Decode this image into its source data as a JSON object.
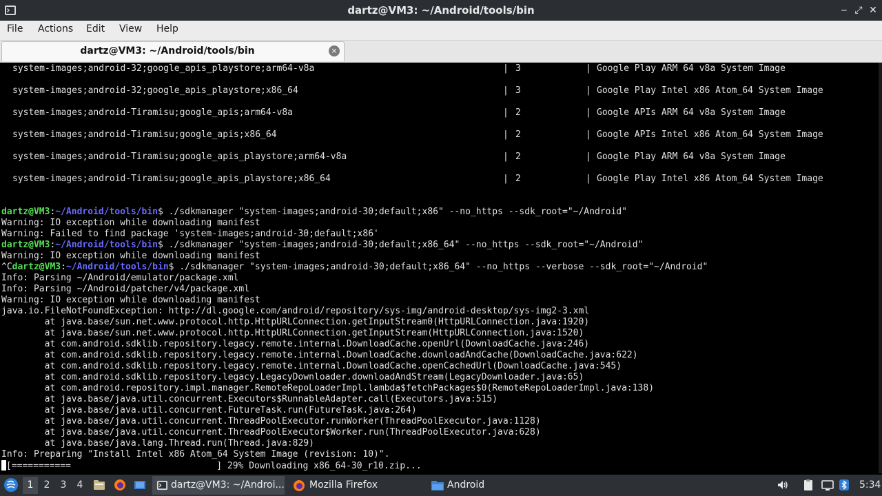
{
  "window": {
    "title": "dartz@VM3: ~/Android/tools/bin",
    "app_icon": "terminal-icon",
    "controls": {
      "minimize": "‒",
      "restore": "⤢",
      "close": "✕"
    }
  },
  "menu": [
    "File",
    "Actions",
    "Edit",
    "View",
    "Help"
  ],
  "tab": {
    "label": "dartz@VM3: ~/Android/tools/bin",
    "close_icon": "×"
  },
  "terminal": {
    "table_rows": [
      {
        "path": "system-images;android-32;google_apis_playstore;arm64-v8a",
        "version": "3",
        "description": "Google Play ARM 64 v8a System Image"
      },
      {
        "path": "system-images;android-32;google_apis_playstore;x86_64",
        "version": "3",
        "description": "Google Play Intel x86 Atom_64 System Image"
      },
      {
        "path": "system-images;android-Tiramisu;google_apis;arm64-v8a",
        "version": "2",
        "description": "Google APIs ARM 64 v8a System Image"
      },
      {
        "path": "system-images;android-Tiramisu;google_apis;x86_64",
        "version": "2",
        "description": "Google APIs Intel x86 Atom_64 System Image"
      },
      {
        "path": "system-images;android-Tiramisu;google_apis_playstore;arm64-v8a",
        "version": "2",
        "description": "Google Play ARM 64 v8a System Image"
      },
      {
        "path": "system-images;android-Tiramisu;google_apis_playstore;x86_64",
        "version": "2",
        "description": "Google Play Intel x86 Atom_64 System Image"
      }
    ],
    "prompt_user": "dartz@VM3",
    "prompt_path": "~/Android/tools/bin",
    "commands": [
      "./sdkmanager \"system-images;android-30;default;x86\" --no_https --sdk_root=\"~/Android\"",
      "./sdkmanager \"system-images;android-30;default;x86_64\" --no_https --sdk_root=\"~/Android\"",
      "./sdkmanager \"system-images;android-30;default;x86_64\" --no_https --verbose --sdk_root=\"~/Android\""
    ],
    "interrupt_prefix": "^C",
    "output_1": [
      "Warning: IO exception while downloading manifest",
      "Warning: Failed to find package 'system-images;android-30;default;x86'"
    ],
    "output_2": [
      "Warning: IO exception while downloading manifest"
    ],
    "output_3": [
      "Info: Parsing ~/Android/emulator/package.xml",
      "Info: Parsing ~/Android/patcher/v4/package.xml",
      "Warning: IO exception while downloading manifest",
      "java.io.FileNotFoundException: http://dl.google.com/android/repository/sys-img/android-desktop/sys-img2-3.xml",
      "        at java.base/sun.net.www.protocol.http.HttpURLConnection.getInputStream0(HttpURLConnection.java:1920)",
      "        at java.base/sun.net.www.protocol.http.HttpURLConnection.getInputStream(HttpURLConnection.java:1520)",
      "        at com.android.sdklib.repository.legacy.remote.internal.DownloadCache.openUrl(DownloadCache.java:246)",
      "        at com.android.sdklib.repository.legacy.remote.internal.DownloadCache.downloadAndCache(DownloadCache.java:622)",
      "        at com.android.sdklib.repository.legacy.remote.internal.DownloadCache.openCachedUrl(DownloadCache.java:545)",
      "        at com.android.sdklib.repository.legacy.LegacyDownloader.downloadAndStream(LegacyDownloader.java:65)",
      "        at com.android.repository.impl.manager.RemoteRepoLoaderImpl.lambda$fetchPackages$0(RemoteRepoLoaderImpl.java:138)",
      "        at java.base/java.util.concurrent.Executors$RunnableAdapter.call(Executors.java:515)",
      "        at java.base/java.util.concurrent.FutureTask.run(FutureTask.java:264)",
      "        at java.base/java.util.concurrent.ThreadPoolExecutor.runWorker(ThreadPoolExecutor.java:1128)",
      "        at java.base/java.util.concurrent.ThreadPoolExecutor$Worker.run(ThreadPoolExecutor.java:628)",
      "        at java.base/java.lang.Thread.run(Thread.java:829)",
      "Info: Preparing \"Install Intel x86 Atom_64 System Image (revision: 10)\"."
    ],
    "progress": {
      "bar": "[===========                           ]",
      "text": "29% Downloading x86_64-30_r10.zip...",
      "percent": 29
    }
  },
  "taskbar": {
    "start_icon": "start-menu-icon",
    "workspaces": [
      "1",
      "2",
      "3",
      "4"
    ],
    "active_workspace": "1",
    "launchers": [
      "file-manager-icon",
      "firefox-icon",
      "show-desktop-icon"
    ],
    "tasks": [
      {
        "label": "dartz@VM3: ~/Androi...",
        "icon": "terminal-icon",
        "active": true
      },
      {
        "label": "Mozilla Firefox",
        "icon": "firefox-icon",
        "active": false
      },
      {
        "label": "Android",
        "icon": "folder-icon",
        "active": false
      }
    ],
    "tray_icons": [
      "volume-icon",
      "clipboard-icon",
      "display-icon",
      "bluetooth-icon"
    ],
    "clock": "5:34"
  }
}
